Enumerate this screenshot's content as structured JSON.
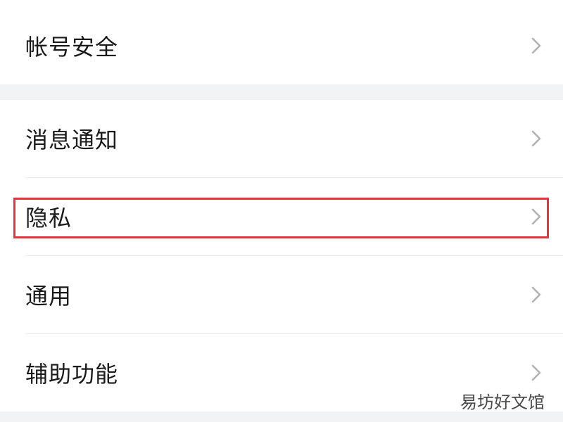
{
  "settings": {
    "group1": [
      {
        "label": "帐号安全",
        "icon": "chevron-right-icon"
      }
    ],
    "group2": [
      {
        "label": "消息通知",
        "icon": "chevron-right-icon"
      },
      {
        "label": "隐私",
        "icon": "chevron-right-icon",
        "highlighted": true
      },
      {
        "label": "通用",
        "icon": "chevron-right-icon"
      },
      {
        "label": "辅助功能",
        "icon": "chevron-right-icon"
      }
    ]
  },
  "watermark": "易坊好文馆",
  "colors": {
    "background": "#f2f3f5",
    "card": "#ffffff",
    "text": "#1a1a1a",
    "chevron": "#b3b3b3",
    "highlight_border": "#e8343a"
  }
}
